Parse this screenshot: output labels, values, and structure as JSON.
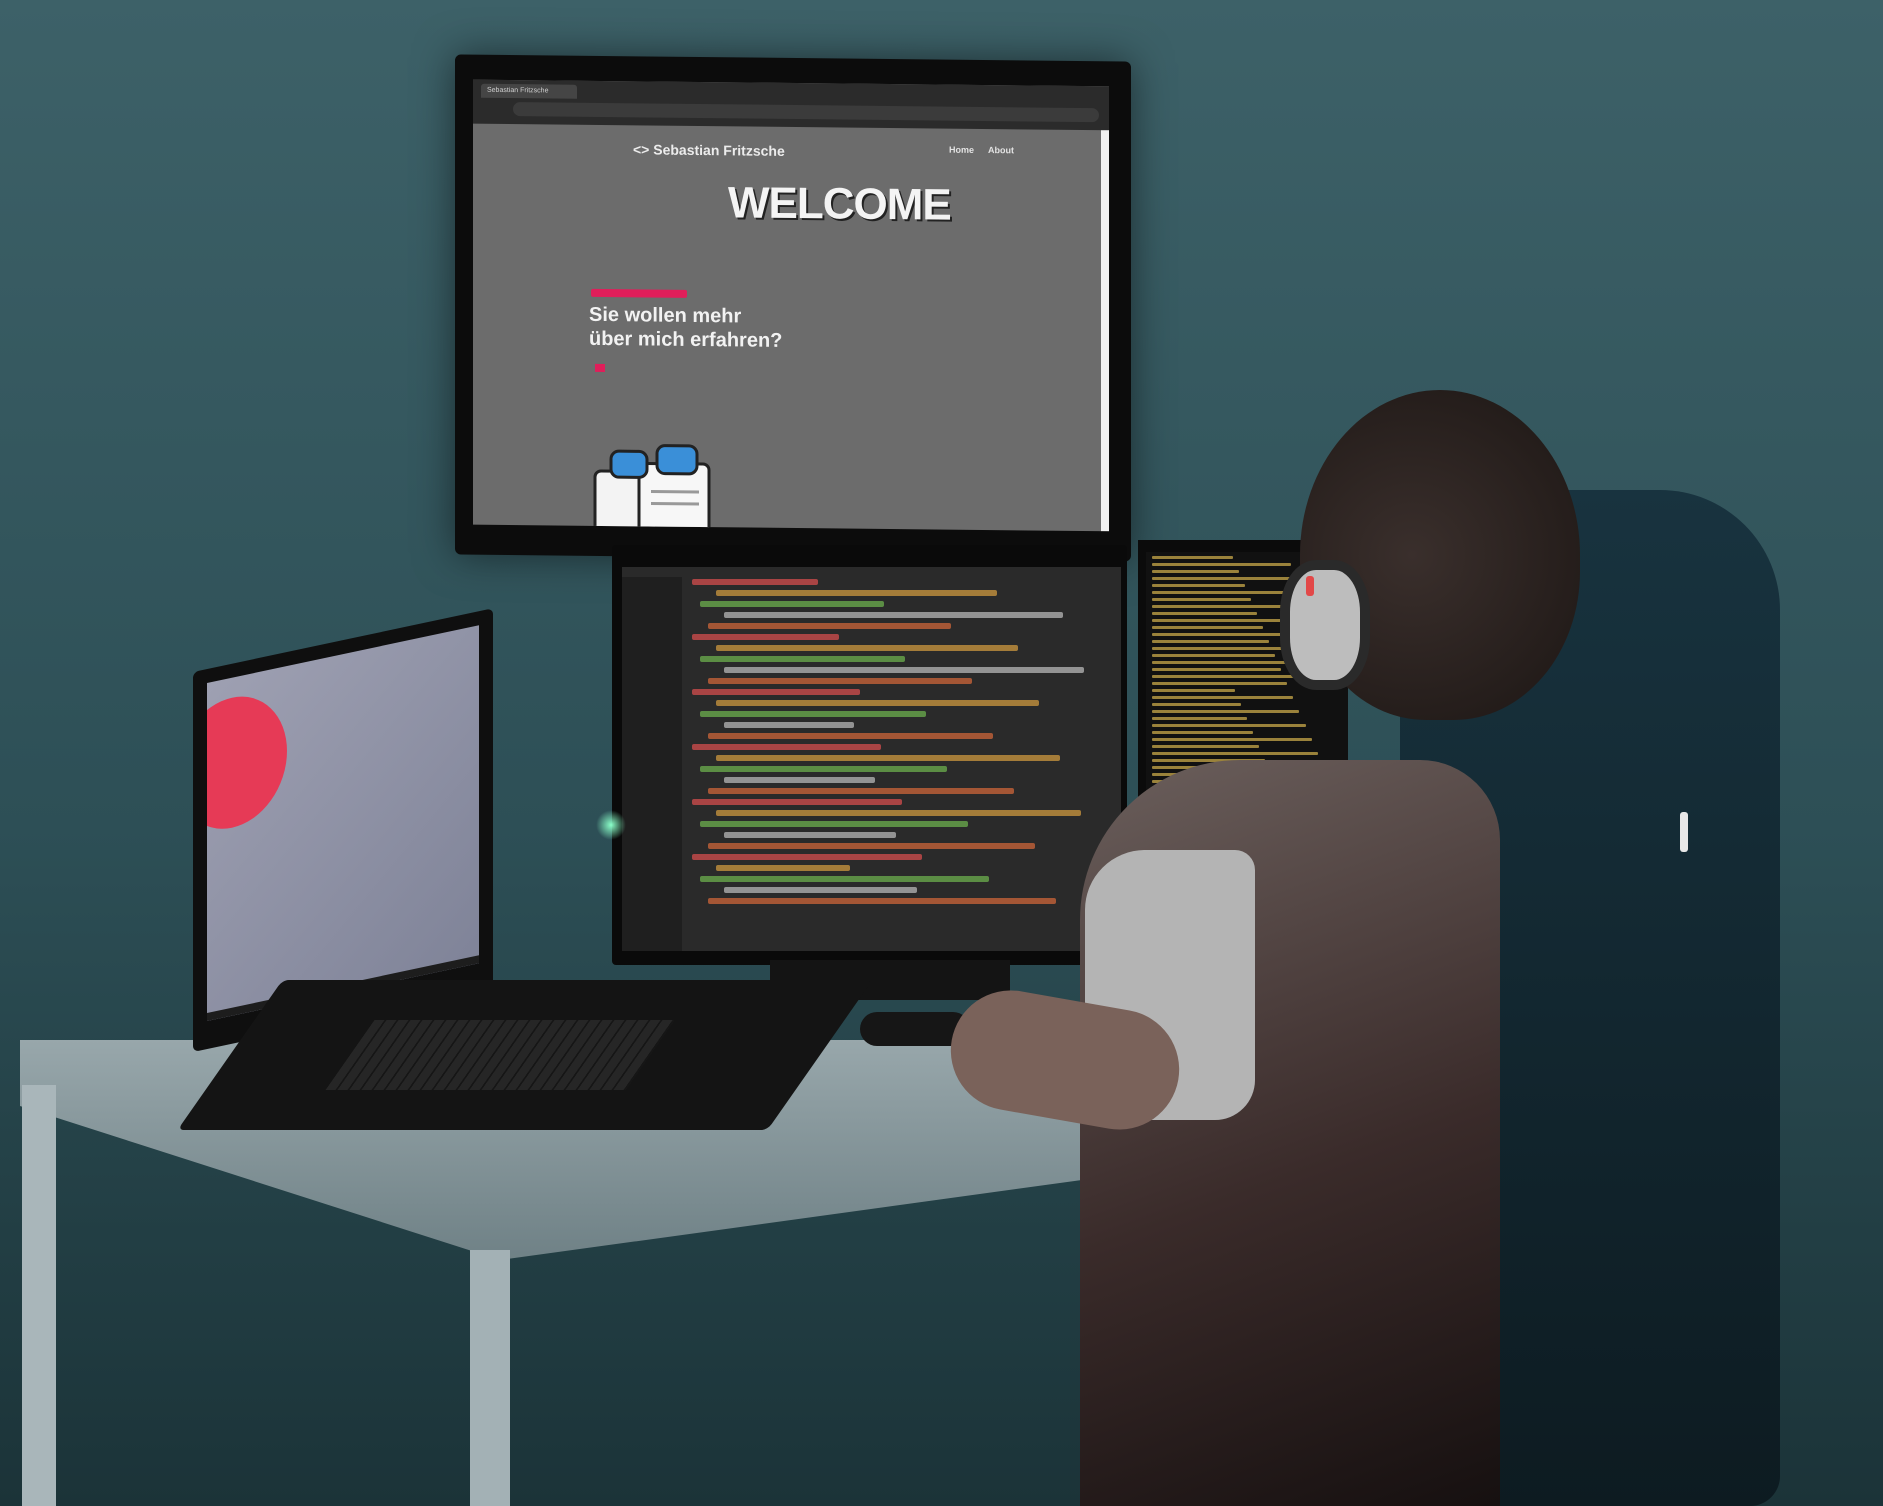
{
  "browser": {
    "tab_title": "Sebastian Fritzsche"
  },
  "website": {
    "logo": "<> Sebastian Fritzsche",
    "nav": [
      "Home",
      "About"
    ],
    "welcome": "WELCOME",
    "headline": "Sie wollen mehr über mich erfahren?",
    "accent_color": "#e01e5a"
  },
  "colors": {
    "wall": "#3d6168",
    "desk": "#98a7ab",
    "terminal_text": "#c8a84a"
  }
}
